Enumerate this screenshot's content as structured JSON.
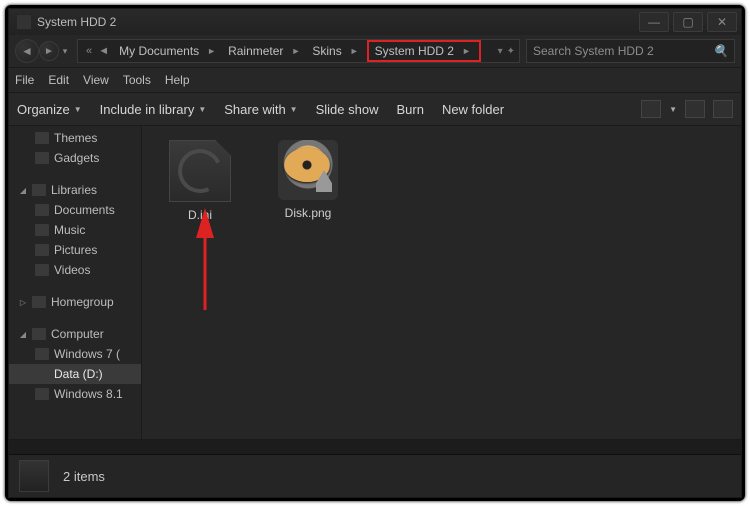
{
  "window": {
    "title": "System HDD 2"
  },
  "breadcrumb": {
    "items": [
      {
        "label": "My Documents"
      },
      {
        "label": "Rainmeter"
      },
      {
        "label": "Skins"
      },
      {
        "label": "System HDD 2",
        "highlight": true
      }
    ]
  },
  "search": {
    "placeholder": "Search System HDD 2"
  },
  "menus": {
    "file": "File",
    "edit": "Edit",
    "view": "View",
    "tools": "Tools",
    "help": "Help"
  },
  "toolbar": {
    "organize": "Organize",
    "include": "Include in library",
    "share": "Share with",
    "slideshow": "Slide show",
    "burn": "Burn",
    "newfolder": "New folder"
  },
  "sidebar": {
    "themes": "Themes",
    "gadgets": "Gadgets",
    "libraries": "Libraries",
    "documents": "Documents",
    "music": "Music",
    "pictures": "Pictures",
    "videos": "Videos",
    "homegroup": "Homegroup",
    "computer": "Computer",
    "win7": "Windows 7 (",
    "dataD": "Data (D:)",
    "win81": "Windows 8.1"
  },
  "files": {
    "ini": "D.ini",
    "disk": "Disk.png"
  },
  "status": {
    "text": "2 items"
  }
}
